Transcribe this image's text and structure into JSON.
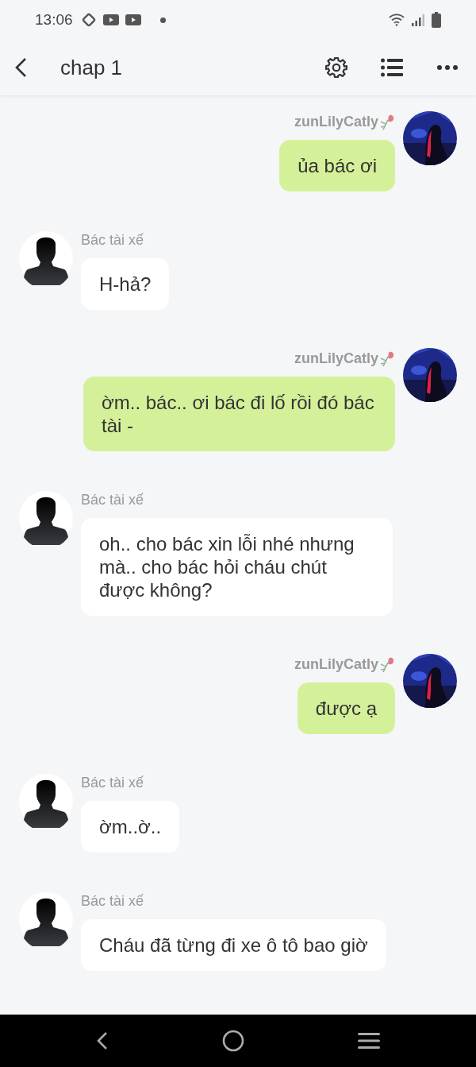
{
  "status_bar": {
    "time": "13:06"
  },
  "header": {
    "title": "chap 1"
  },
  "messages": [
    {
      "kind": "self",
      "sender": "zunLilyCatly",
      "lines": [
        "ủa bác ơi"
      ]
    },
    {
      "kind": "other",
      "sender": "Bác tài xế",
      "lines": [
        "H-hả?"
      ]
    },
    {
      "kind": "self",
      "sender": "zunLilyCatly",
      "lines": [
        "ờm.. bác.. ơi bác đi lố rồi đó bác tài -"
      ]
    },
    {
      "kind": "other",
      "sender": "Bác tài xế",
      "lines": [
        "oh.. cho bác xin lỗi nhé nhưng mà.. cho bác hỏi cháu chút được không?"
      ]
    },
    {
      "kind": "self",
      "sender": "zunLilyCatly",
      "lines": [
        "được ạ"
      ]
    },
    {
      "kind": "other",
      "sender": "Bác tài xế",
      "lines": [
        "ờm..ờ.."
      ]
    },
    {
      "kind": "other",
      "sender": "Bác tài xế",
      "lines": [
        "Cháu đã từng đi xe ô tô bao giờ"
      ]
    }
  ]
}
